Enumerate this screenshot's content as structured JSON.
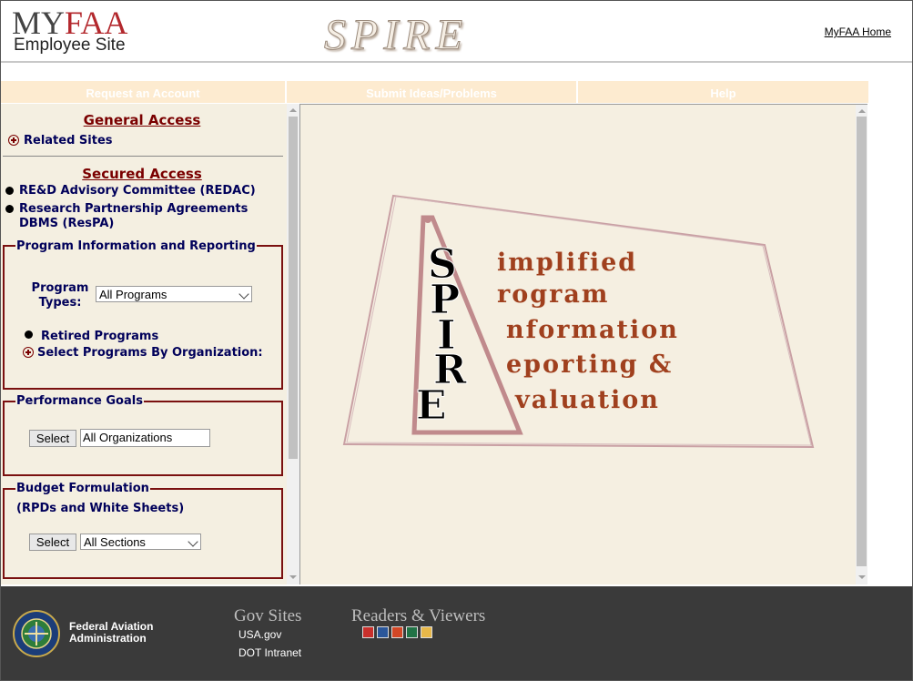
{
  "header": {
    "logo_my": "MY",
    "logo_faa": "FAA",
    "logo_sub": "Employee Site",
    "app_title": "SPIRE",
    "home_link": "MyFAA Home"
  },
  "nav": {
    "items": [
      "Request an Account",
      "Submit Ideas/Problems",
      "Help"
    ]
  },
  "left": {
    "general_access": "General Access",
    "related_sites": "Related Sites",
    "secured_access": "Secured Access",
    "redac": "RE&D Advisory Committee (REDAC)",
    "respa_line1": "Research Partnership Agreements",
    "respa_line2": "DBMS (ResPA)",
    "program_info": {
      "legend": "Program Information and Reporting",
      "types_label_1": "Program",
      "types_label_2": "Types:",
      "types_value": "All Programs",
      "retired": "Retired Programs",
      "by_org": "Select Programs By Organization:"
    },
    "performance": {
      "legend": "Performance Goals",
      "button": "Select",
      "value": "All Organizations"
    },
    "budget": {
      "legend": "Budget Formulation",
      "subtitle": "(RPDs and White Sheets)",
      "button": "Select",
      "value": "All Sections"
    }
  },
  "spire_graphic": {
    "letters": [
      "S",
      "P",
      "I",
      "R",
      "E"
    ],
    "words": [
      "implified",
      "rogram",
      "nformation",
      "eporting &",
      "valuation"
    ],
    "accent_color": "#a0401e"
  },
  "footer": {
    "agency_line1": "Federal Aviation",
    "agency_line2": "Administration",
    "gov_sites_heading": "Gov Sites",
    "gov_links": [
      "USA.gov",
      "DOT Intranet"
    ],
    "readers_heading": "Readers & Viewers",
    "viewer_icons": [
      "pdf-icon",
      "word-icon",
      "powerpoint-icon",
      "excel-icon",
      "viewer-icon"
    ]
  }
}
